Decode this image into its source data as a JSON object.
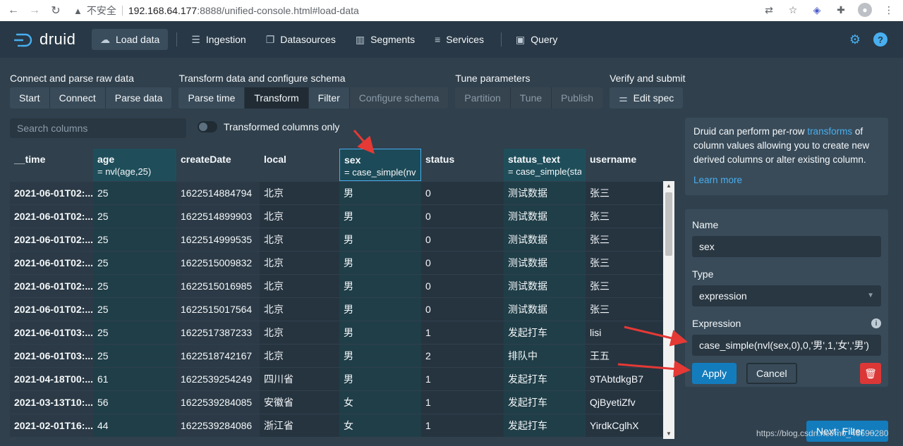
{
  "browser": {
    "insecure_label": "不安全",
    "url_host": "192.168.64.177",
    "url_path": ":8888/unified-console.html#load-data"
  },
  "header": {
    "brand": "druid",
    "nav": [
      "Load data",
      "Ingestion",
      "Datasources",
      "Segments",
      "Services",
      "Query"
    ],
    "active": "Load data"
  },
  "steps": {
    "groups": [
      {
        "title": "Connect and parse raw data",
        "items": [
          "Start",
          "Connect",
          "Parse data"
        ]
      },
      {
        "title": "Transform data and configure schema",
        "items": [
          "Parse time",
          "Transform",
          "Filter",
          "Configure schema"
        ]
      },
      {
        "title": "Tune parameters",
        "items": [
          "Partition",
          "Tune",
          "Publish"
        ]
      },
      {
        "title": "Verify and submit",
        "items": [
          "Edit spec"
        ]
      }
    ]
  },
  "filters": {
    "search_placeholder": "Search columns",
    "toggle_label": "Transformed columns only"
  },
  "table": {
    "columns": [
      {
        "name": "__time",
        "expr": ""
      },
      {
        "name": "age",
        "expr": "= nvl(age,25)"
      },
      {
        "name": "createDate",
        "expr": ""
      },
      {
        "name": "local",
        "expr": ""
      },
      {
        "name": "sex",
        "expr": "= case_simple(nvl("
      },
      {
        "name": "status",
        "expr": ""
      },
      {
        "name": "status_text",
        "expr": "= case_simple(stat"
      },
      {
        "name": "username",
        "expr": ""
      }
    ],
    "rows": [
      [
        "2021-06-01T02:...",
        "25",
        "1622514884794",
        "北京",
        "男",
        "0",
        "测试数据",
        "张三"
      ],
      [
        "2021-06-01T02:...",
        "25",
        "1622514899903",
        "北京",
        "男",
        "0",
        "测试数据",
        "张三"
      ],
      [
        "2021-06-01T02:...",
        "25",
        "1622514999535",
        "北京",
        "男",
        "0",
        "测试数据",
        "张三"
      ],
      [
        "2021-06-01T02:...",
        "25",
        "1622515009832",
        "北京",
        "男",
        "0",
        "测试数据",
        "张三"
      ],
      [
        "2021-06-01T02:...",
        "25",
        "1622515016985",
        "北京",
        "男",
        "0",
        "测试数据",
        "张三"
      ],
      [
        "2021-06-01T02:...",
        "25",
        "1622515017564",
        "北京",
        "男",
        "0",
        "测试数据",
        "张三"
      ],
      [
        "2021-06-01T03:...",
        "25",
        "1622517387233",
        "北京",
        "男",
        "1",
        "发起打车",
        "lisi"
      ],
      [
        "2021-06-01T03:...",
        "25",
        "1622518742167",
        "北京",
        "男",
        "2",
        "排队中",
        "王五"
      ],
      [
        "2021-04-18T00:...",
        "61",
        "1622539254249",
        "四川省",
        "男",
        "1",
        "发起打车",
        "9TAbtdkgB7"
      ],
      [
        "2021-03-13T10:...",
        "56",
        "1622539284085",
        "安徽省",
        "女",
        "1",
        "发起打车",
        "QjByetiZfv"
      ],
      [
        "2021-02-01T16:...",
        "44",
        "1622539284086",
        "浙江省",
        "女",
        "1",
        "发起打车",
        "YirdkCglhX"
      ]
    ]
  },
  "info": {
    "text_before": "Druid can perform per-row ",
    "link": "transforms",
    "text_after": " of column values allowing you to create new derived columns or alter existing column.",
    "learn_more": "Learn more"
  },
  "form": {
    "name_label": "Name",
    "name_value": "sex",
    "type_label": "Type",
    "type_value": "expression",
    "expr_label": "Expression",
    "expr_value": "case_simple(nvl(sex,0),0,'男',1,'女','男')",
    "apply": "Apply",
    "cancel": "Cancel"
  },
  "next_button": "Next: Filter",
  "watermark": "https://blog.csdn.net/m0_46690280",
  "colors": {
    "accent": "#48aff0",
    "primary": "#137cbd",
    "danger": "#db3737",
    "annotation": "#e53935"
  }
}
